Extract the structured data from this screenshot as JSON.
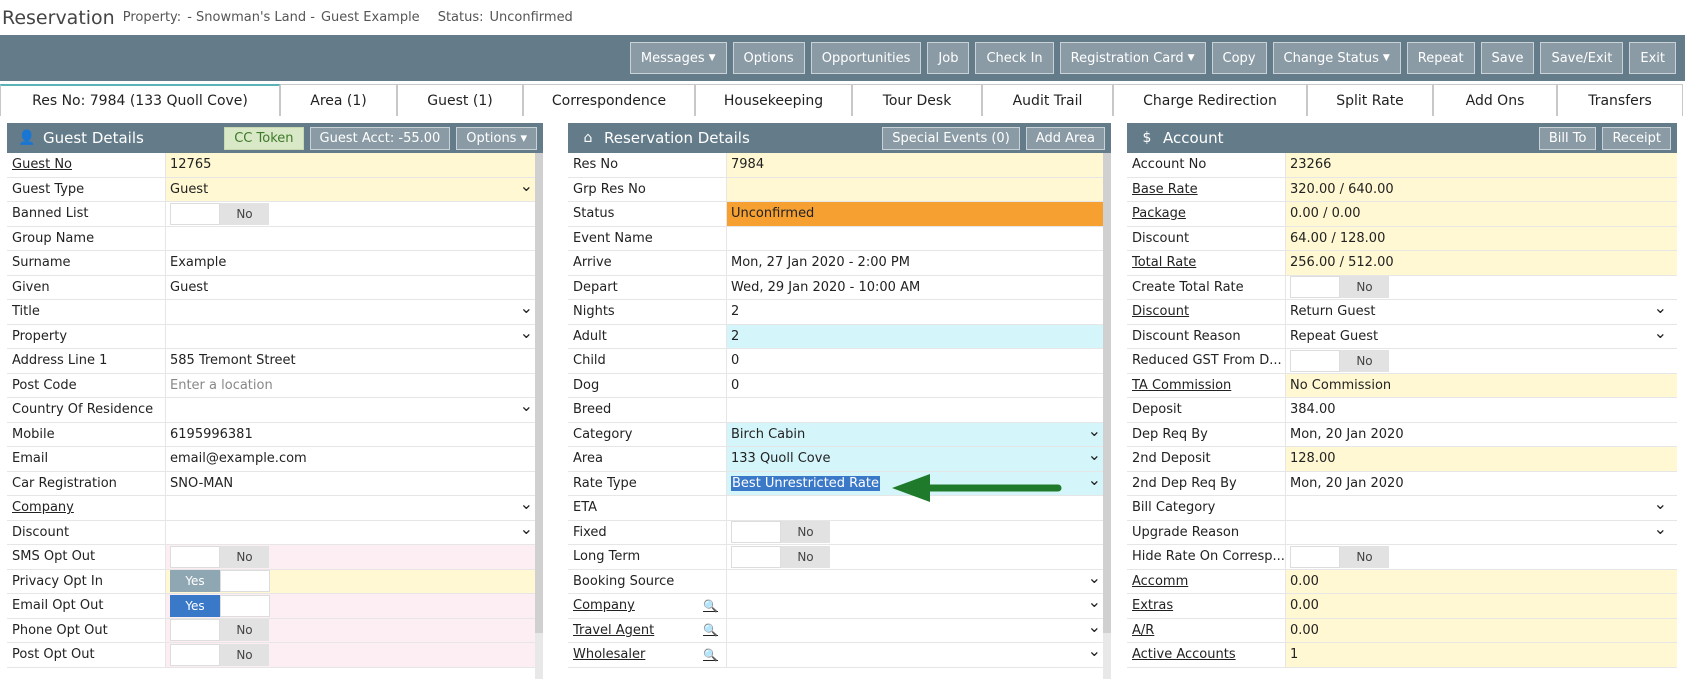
{
  "title": {
    "app": "Reservation",
    "property_label": "Property:",
    "property_value": "- Snowman's Land -",
    "guest": "Guest Example",
    "status_label": "Status:",
    "status_value": "Unconfirmed"
  },
  "toolbar": [
    {
      "label": "Messages",
      "dropdown": true
    },
    {
      "label": "Options",
      "dropdown": false
    },
    {
      "label": "Opportunities",
      "dropdown": false
    },
    {
      "label": "Job",
      "dropdown": false
    },
    {
      "label": "Check In",
      "dropdown": false
    },
    {
      "label": "Registration Card",
      "dropdown": true
    },
    {
      "label": "Copy",
      "dropdown": false
    },
    {
      "label": "Change Status",
      "dropdown": true
    },
    {
      "label": "Repeat",
      "dropdown": false
    },
    {
      "label": "Save",
      "dropdown": false
    },
    {
      "label": "Save/Exit",
      "dropdown": false
    },
    {
      "label": "Exit",
      "dropdown": false
    }
  ],
  "tabs": [
    {
      "label": "Res No: 7984 (133 Quoll Cove)",
      "active": true
    },
    {
      "label": "Area (1)"
    },
    {
      "label": "Guest (1)"
    },
    {
      "label": "Correspondence"
    },
    {
      "label": "Housekeeping"
    },
    {
      "label": "Tour Desk"
    },
    {
      "label": "Audit Trail"
    },
    {
      "label": "Charge Redirection"
    },
    {
      "label": "Split Rate"
    },
    {
      "label": "Add Ons"
    },
    {
      "label": "Transfers"
    }
  ],
  "guest_panel": {
    "title": "Guest Details",
    "icon": "user-icon",
    "buttons": [
      {
        "label": "CC Token",
        "style": "token"
      },
      {
        "label": "Guest Acct: -55.00"
      },
      {
        "label": "Options",
        "dropdown": true
      }
    ],
    "rows": [
      {
        "label": "Guest No",
        "value": "12765",
        "bg": "yellow",
        "link": true
      },
      {
        "label": "Guest Type",
        "value": "Guest",
        "bg": "yellow",
        "dropdown": true
      },
      {
        "label": "Banned List",
        "toggle": "no"
      },
      {
        "label": "Group Name",
        "value": ""
      },
      {
        "label": "Surname",
        "value": "Example"
      },
      {
        "label": "Given",
        "value": "Guest"
      },
      {
        "label": "Title",
        "value": "",
        "dropdown": true
      },
      {
        "label": "Property",
        "value": "",
        "dropdown": true
      },
      {
        "label": "Address Line 1",
        "value": "585 Tremont Street"
      },
      {
        "label": "Post Code",
        "placeholder": "Enter a location"
      },
      {
        "label": "Country Of Residence",
        "value": "",
        "dropdown": true
      },
      {
        "label": "Mobile",
        "value": "6195996381"
      },
      {
        "label": "Email",
        "value": "email@example.com"
      },
      {
        "label": "Car Registration",
        "value": "SNO-MAN"
      },
      {
        "label": "Company",
        "value": "",
        "dropdown": true,
        "link": true
      },
      {
        "label": "Discount",
        "value": "",
        "dropdown": true
      },
      {
        "label": "SMS Opt Out",
        "toggle": "no",
        "bg": "pink"
      },
      {
        "label": "Privacy Opt In",
        "toggle": "yes-grey",
        "bg": "yellow"
      },
      {
        "label": "Email Opt Out",
        "toggle": "yes-blue",
        "bg": "pink"
      },
      {
        "label": "Phone Opt Out",
        "toggle": "no",
        "bg": "pink"
      },
      {
        "label": "Post Opt Out",
        "toggle": "no",
        "bg": "pink"
      }
    ]
  },
  "res_panel": {
    "title": "Reservation Details",
    "icon": "home-icon",
    "buttons": [
      {
        "label": "Special Events (0)"
      },
      {
        "label": "Add Area"
      }
    ],
    "rows": [
      {
        "label": "Res No",
        "value": "7984",
        "bg": "yellow"
      },
      {
        "label": "Grp Res No",
        "value": "",
        "bg": "yellow"
      },
      {
        "label": "Status",
        "value": "Unconfirmed",
        "bg": "orange"
      },
      {
        "label": "Event Name",
        "value": ""
      },
      {
        "label": "Arrive",
        "value": "Mon, 27 Jan 2020 - 2:00 PM"
      },
      {
        "label": "Depart",
        "value": "Wed, 29 Jan 2020 - 10:00 AM"
      },
      {
        "label": "Nights",
        "value": "2"
      },
      {
        "label": "Adult",
        "value": "2",
        "bg": "cyan"
      },
      {
        "label": "Child",
        "value": "0"
      },
      {
        "label": "Dog",
        "value": "0"
      },
      {
        "label": "Breed",
        "value": ""
      },
      {
        "label": "Category",
        "value": "Birch Cabin",
        "bg": "cyan",
        "dropdown": true
      },
      {
        "label": "Area",
        "value": "133 Quoll Cove",
        "bg": "cyan",
        "dropdown": true
      },
      {
        "label": "Rate Type",
        "value": "Best Unrestricted Rate",
        "bg": "cyan",
        "dropdown": true,
        "selected": true
      },
      {
        "label": "ETA",
        "value": ""
      },
      {
        "label": "Fixed",
        "toggle": "no"
      },
      {
        "label": "Long Term",
        "toggle": "no"
      },
      {
        "label": "Booking Source",
        "value": "",
        "dropdown": true
      },
      {
        "label": "Company",
        "value": "",
        "dropdown": true,
        "link": true,
        "search": true
      },
      {
        "label": "Travel Agent",
        "value": "",
        "dropdown": true,
        "link": true,
        "search": true
      },
      {
        "label": "Wholesaler",
        "value": "",
        "dropdown": true,
        "link": true,
        "search": true
      }
    ]
  },
  "acct_panel": {
    "title": "Account",
    "icon": "dollar-icon",
    "buttons": [
      {
        "label": "Bill To"
      },
      {
        "label": "Receipt"
      }
    ],
    "rows": [
      {
        "label": "Account No",
        "value": "23266",
        "bg": "yellow"
      },
      {
        "label": "Base Rate",
        "value": "320.00 / 640.00",
        "bg": "yellow",
        "link": true
      },
      {
        "label": "Package",
        "value": "0.00 / 0.00",
        "bg": "yellow",
        "link": true
      },
      {
        "label": "Discount",
        "value": "64.00 / 128.00",
        "bg": "yellow"
      },
      {
        "label": "Total Rate",
        "value": "256.00 / 512.00",
        "bg": "yellow",
        "link": true
      },
      {
        "label": "Create Total Rate",
        "toggle": "no"
      },
      {
        "label": "Discount",
        "value": "Return Guest",
        "dropdown": true,
        "link": true
      },
      {
        "label": "Discount Reason",
        "value": "Repeat Guest",
        "dropdown": true
      },
      {
        "label": "Reduced GST From D...",
        "toggle": "no"
      },
      {
        "label": "TA Commission",
        "value": "No Commission",
        "bg": "yellow",
        "link": true
      },
      {
        "label": "Deposit",
        "value": "384.00"
      },
      {
        "label": "Dep Req By",
        "value": "Mon, 20 Jan 2020"
      },
      {
        "label": "2nd Deposit",
        "value": "128.00",
        "bg": "yellow"
      },
      {
        "label": "2nd Dep Req By",
        "value": "Mon, 20 Jan 2020"
      },
      {
        "label": "Bill Category",
        "value": "",
        "dropdown": true
      },
      {
        "label": "Upgrade Reason",
        "value": "",
        "dropdown": true
      },
      {
        "label": "Hide Rate On Corresp...",
        "toggle": "no"
      },
      {
        "label": "Accomm",
        "value": "0.00",
        "bg": "yellow",
        "link": true
      },
      {
        "label": "Extras",
        "value": "0.00",
        "bg": "yellow",
        "link": true
      },
      {
        "label": "A/R",
        "value": "0.00",
        "bg": "yellow",
        "link": true
      },
      {
        "label": "Active Accounts",
        "value": "1",
        "bg": "yellow",
        "link": true
      }
    ]
  },
  "toggle_text": {
    "no": "No",
    "yes": "Yes"
  },
  "icons": {
    "dropdown": "chevron-down-icon",
    "search": "search-icon",
    "annotation": "green-arrow-icon"
  },
  "colors": {
    "header": "#647c8a",
    "button": "#8a9ba5",
    "yellow": "#fff8d2",
    "cyan": "#d4f6fa",
    "orange": "#f5a030",
    "pink": "#fdeef3",
    "arrow": "#1f7a2c"
  }
}
